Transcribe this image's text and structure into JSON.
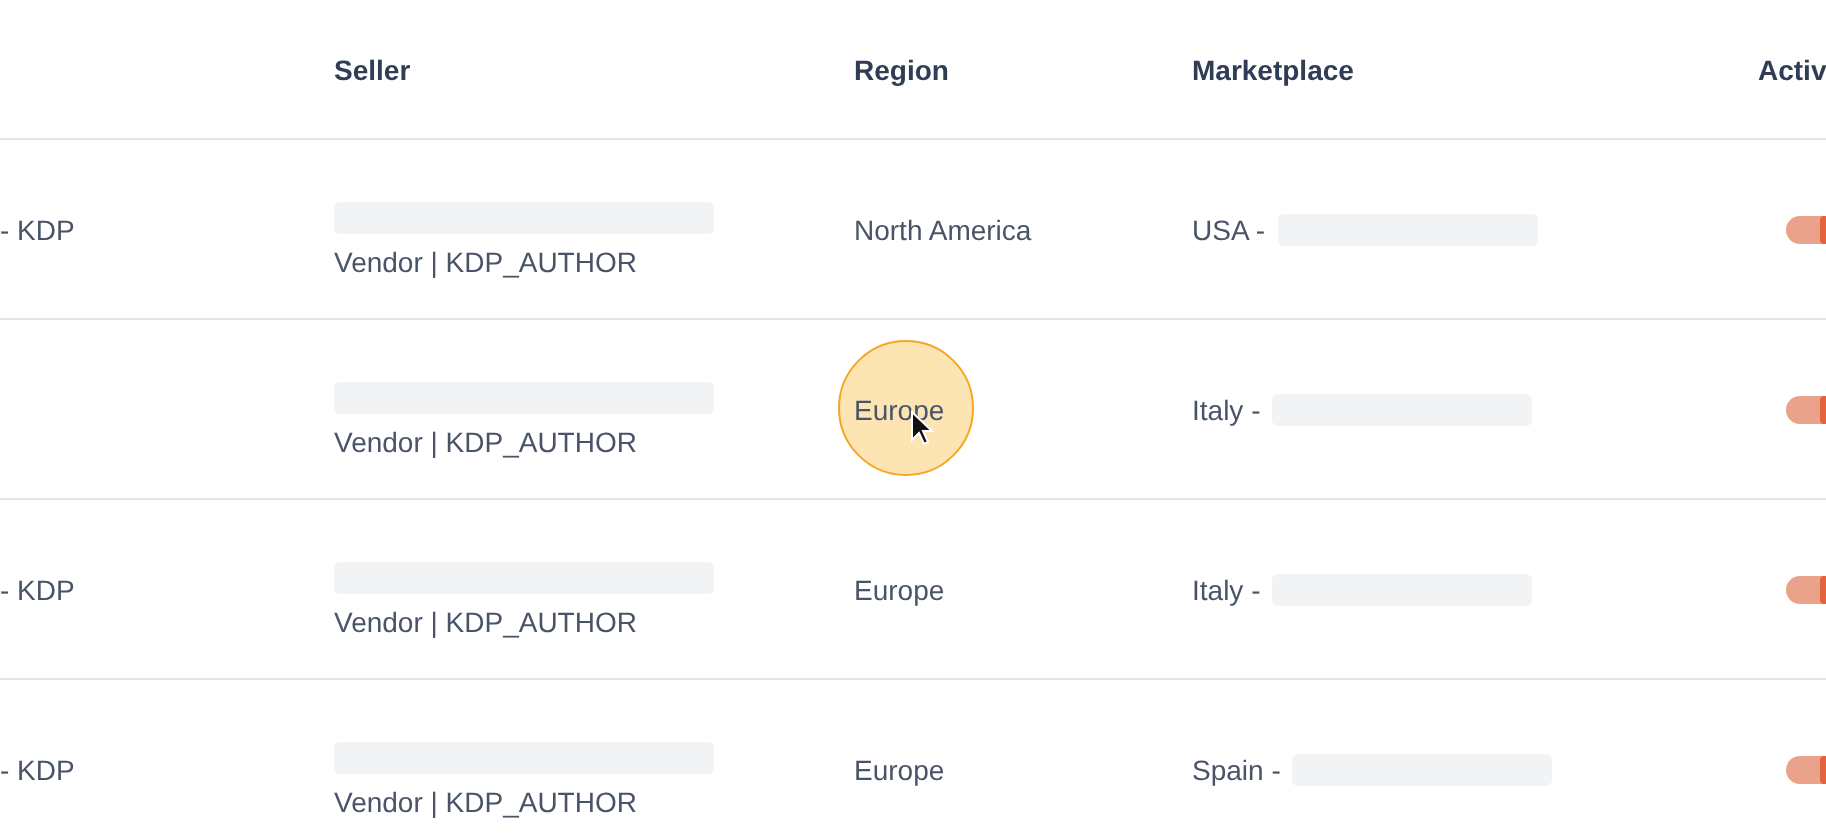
{
  "table": {
    "columns": [
      "Seller",
      "Region",
      "Marketplace",
      "Activ"
    ],
    "rows": [
      {
        "column_1": "- KDP",
        "seller_type": "Vendor | KDP_AUTHOR",
        "region": "North America",
        "marketplace": "USA -",
        "active": true,
        "cursor_highlight": false
      },
      {
        "seller_type": "Vendor | KDP_AUTHOR",
        "region": "Europe",
        "marketplace": "Italy -",
        "active": true,
        "cursor_highlight": true
      },
      {
        "column_1": "- KDP",
        "seller_type": "Vendor | KDP_AUTHOR",
        "region": "Europe",
        "marketplace": "Italy -",
        "active": true,
        "cursor_highlight": false
      },
      {
        "column_1": "- KDP",
        "seller_type": "Vendor | KDP_AUTHOR",
        "region": "Europe",
        "marketplace": "Spain -",
        "active": true,
        "cursor_highlight": false
      }
    ]
  }
}
